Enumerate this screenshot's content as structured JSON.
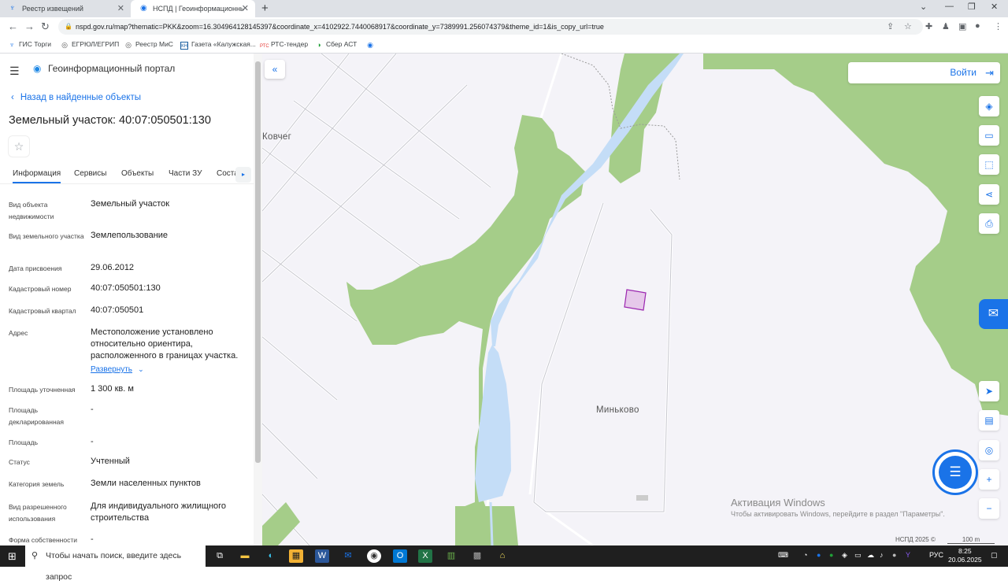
{
  "browser": {
    "tabs": [
      {
        "title": "Реестр извещений",
        "active": false
      },
      {
        "title": "НСПД | Геоинформационный п...",
        "active": true
      }
    ],
    "url": "nspd.gov.ru/map?thematic=PKK&zoom=16.304964128145397&coordinate_x=4102922.7440068917&coordinate_y=7389991.256074379&theme_id=1&is_copy_url=true",
    "bookmarks": [
      "ГИС Торги",
      "ЕГРЮЛ/ЕГРИП",
      "Реестр МиС",
      "Газета «Калужская...",
      "РТС-тендер",
      "Сбер АСТ"
    ]
  },
  "panel": {
    "portal_title": "Геоинформационный портал",
    "back_link": "Назад в найденные объекты",
    "object_title": "Земельный участок: 40:07:050501:130",
    "tabs": [
      "Информация",
      "Сервисы",
      "Объекты",
      "Части ЗУ",
      "Соста"
    ],
    "rows": [
      {
        "label": "Вид объекта недвижимости",
        "value": "Земельный участок"
      },
      {
        "label": "Вид земельного участка",
        "value": "Землепользование"
      },
      {
        "label": "Дата присвоения",
        "value": "29.06.2012"
      },
      {
        "label": "Кадастровый номер",
        "value": "40:07:050501:130"
      },
      {
        "label": "Кадастровый квартал",
        "value": "40:07:050501"
      },
      {
        "label": "Адрес",
        "value": "Местоположение установлено относительно ориентира, расположенного в границах участка."
      },
      {
        "label": "Площадь уточненная",
        "value": "1 300 кв. м"
      },
      {
        "label": "Площадь декларированная",
        "value": "-"
      },
      {
        "label": "Площадь",
        "value": "-"
      },
      {
        "label": "Статус",
        "value": "Учтенный"
      },
      {
        "label": "Категория земель",
        "value": "Земли населенных пунктов"
      },
      {
        "label": "Вид разрешенного использования",
        "value": "Для индивидуального жилищного строительства"
      },
      {
        "label": "Форма собственности",
        "value": "-"
      }
    ],
    "expand_label": "Развернуть"
  },
  "map": {
    "login_label": "Войти",
    "places": [
      "Ковчег",
      "Миньково"
    ],
    "activation_title": "Активация Windows",
    "activation_text": "Чтобы активировать Windows, перейдите в раздел \"Параметры\".",
    "copyright": "НСПД 2025 ©",
    "scale": "100 m",
    "colors": {
      "forest": "#a5cd89",
      "water": "#c4ddf7",
      "land": "#f4f3f8",
      "parcel": "#e6c8ea",
      "accent": "#1a73e8"
    }
  },
  "taskbar": {
    "search_placeholder": "Чтобы начать поиск, введите здесь запрос",
    "lang": "РУС",
    "time": "8:25",
    "date": "20.06.2025"
  }
}
